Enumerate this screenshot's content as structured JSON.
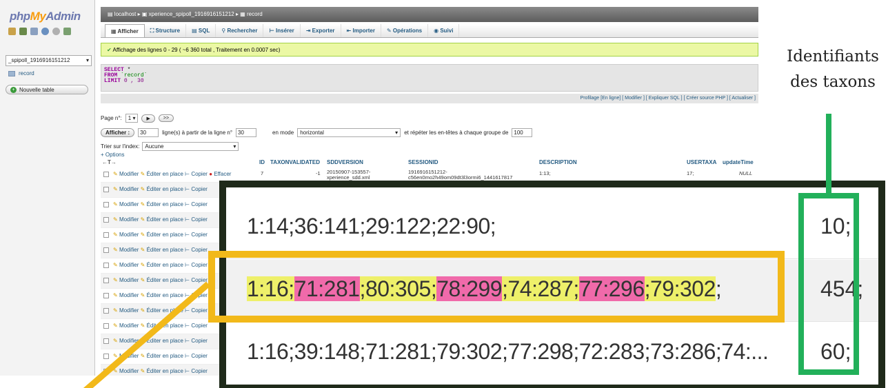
{
  "sidebar": {
    "logo": {
      "php": "php",
      "my": "My",
      "admin": "Admin"
    },
    "database": "_spipoll_1916916151212",
    "table": "record",
    "new_table": "Nouvelle table"
  },
  "breadcrumb": {
    "server": "localhost",
    "database": "xperience_spipoll_1916916151212",
    "table": "record"
  },
  "tabs": [
    {
      "label": "Afficher"
    },
    {
      "label": "Structure"
    },
    {
      "label": "SQL"
    },
    {
      "label": "Rechercher"
    },
    {
      "label": "Insérer"
    },
    {
      "label": "Exporter"
    },
    {
      "label": "Importer"
    },
    {
      "label": "Opérations"
    },
    {
      "label": "Suivi"
    }
  ],
  "success_message": "Affichage des lignes 0 - 29 ( ~6 360 total , Traitement en 0.0007 sec)",
  "sql": {
    "select": "SELECT",
    "select_star": "*",
    "from": "FROM",
    "table": "`record`",
    "limit": "LIMIT",
    "limit_values": "0 , 30"
  },
  "profiling_links": "Profilage [En ligne] [ Modifier ] [ Expliquer SQL ] [ Créer source PHP ] [ Actualiser ]",
  "pager": {
    "label": "Page n°:",
    "page": "1",
    "next": "▶",
    "last": ">>"
  },
  "afficher_row": {
    "button": "Afficher :",
    "count": "30",
    "text1": "ligne(s) à partir de la ligne n°",
    "start": "30",
    "mode_label": "en mode",
    "mode": "horizontal",
    "repeat_label": "et répéter les en-têtes à chaque groupe de",
    "repeat": "100"
  },
  "sort": {
    "label": "Trier sur l'index:",
    "value": "Aucune"
  },
  "options_link": "+ Options",
  "columns": [
    "ID",
    "TAXONVALIDATED",
    "SDDVERSION",
    "SESSIONID",
    "DESCRIPTION",
    "USERTAXA",
    "updateTime"
  ],
  "row_actions": {
    "edit": "Modifier",
    "inline": "Éditer en place",
    "copy": "Copier",
    "delete": "Effacer"
  },
  "first_row": {
    "id": "7",
    "taxonvalidated": "-1",
    "sddversion": "20150907-153557-xperience_sdd.xml",
    "sessionid": "1916916151212-c56en0mo2h49om09dt3l3ormi6_1441617817",
    "description": "1:13;",
    "usertaxa": "17;",
    "updatetime": "NULL"
  },
  "zoom_rows": [
    {
      "description": "1:14;36:141;29:122;22:90;",
      "usertaxa": "10;"
    },
    {
      "description_segments": [
        {
          "text": "1:16;",
          "hl": "y"
        },
        {
          "text": "71:281",
          "hl": "p"
        },
        {
          "text": ";80:305;",
          "hl": "y"
        },
        {
          "text": "78:299",
          "hl": "p"
        },
        {
          "text": ";74:287;",
          "hl": "y"
        },
        {
          "text": "77:296",
          "hl": "p"
        },
        {
          "text": ";79:302",
          "hl": "y"
        },
        {
          "text": ";",
          "hl": ""
        }
      ],
      "usertaxa": "454;"
    },
    {
      "description": "1:16;39:148;71:281;79:302;77:298;72:283;73:286;74:...",
      "usertaxa": "60;"
    }
  ],
  "annotation": {
    "line1": "Identifiants",
    "line2": "des taxons"
  },
  "colors": {
    "highlight_yellow": "#eef06a",
    "highlight_pink": "#f06aaa",
    "orange_frame": "#f2b91a",
    "green_frame": "#22b05a",
    "zoom_frame": "#1f2a1a"
  }
}
